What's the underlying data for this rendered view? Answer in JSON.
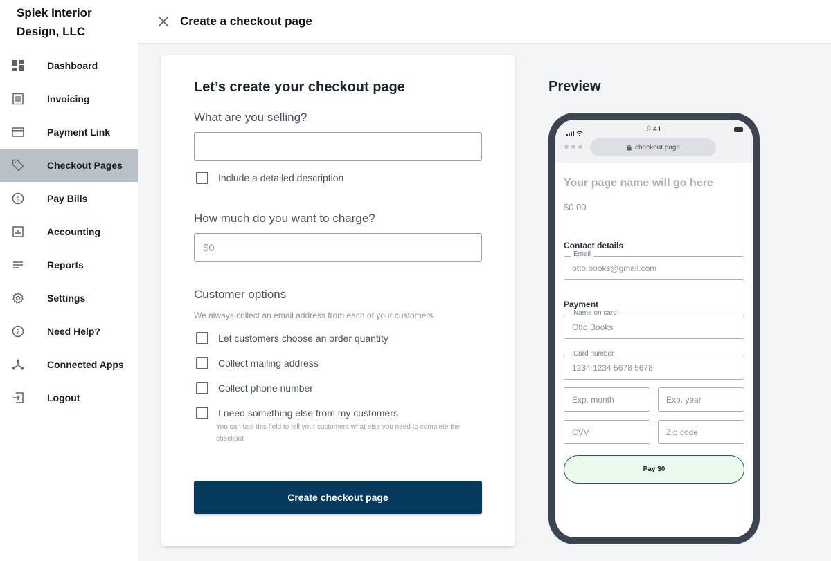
{
  "brand": {
    "name": "Spiek Interior Design, LLC"
  },
  "sidebar": {
    "items": [
      {
        "label": "Dashboard",
        "icon": "dashboard-icon"
      },
      {
        "label": "Invoicing",
        "icon": "invoice-icon"
      },
      {
        "label": "Payment Link",
        "icon": "credit-card-icon"
      },
      {
        "label": "Checkout Pages",
        "icon": "tag-icon",
        "active": true
      },
      {
        "label": "Pay Bills",
        "icon": "dollar-circle-icon"
      },
      {
        "label": "Accounting",
        "icon": "bar-chart-icon"
      },
      {
        "label": "Reports",
        "icon": "lines-icon"
      },
      {
        "label": "Settings",
        "icon": "gear-icon"
      },
      {
        "label": "Need Help?",
        "icon": "help-circle-icon"
      },
      {
        "label": "Connected Apps",
        "icon": "connected-nodes-icon"
      },
      {
        "label": "Logout",
        "icon": "logout-icon"
      }
    ]
  },
  "header": {
    "title": "Create a checkout page"
  },
  "form": {
    "title": "Let’s create your checkout page",
    "selling_label": "What are you selling?",
    "selling_value": "",
    "description_checkbox": "Include a detailed description",
    "charge_label": "How much do you want to charge?",
    "charge_placeholder": "$0",
    "customer_options_title": "Customer options",
    "customer_options_helper": "We always collect an email address from each of your customers",
    "options": [
      "Let customers choose an order quantity",
      "Collect mailing address",
      "Collect phone number",
      "I need something else from my customers"
    ],
    "something_else_helper": "You can use this field to tell your customers what else you need to complete the checkout",
    "submit_label": "Create checkout page"
  },
  "preview": {
    "title": "Preview",
    "time": "9:41",
    "url": "checkout.page",
    "page_name": "Your page name will go here",
    "amount": "$0.00",
    "contact_title": "Contact details",
    "email_label": "Email",
    "email_value": "otto.books@gmail.com",
    "payment_title": "Payment",
    "name_label": "Name on card",
    "name_value": "Otto Books",
    "card_label": "Card number",
    "card_value": "1234 1234 5678 5678",
    "exp_month": "Exp. month",
    "exp_year": "Exp. year",
    "cvv": "CVV",
    "zip": "Zip code",
    "pay_label": "Pay $0"
  },
  "colors": {
    "primary": "#053a5c",
    "sidebar_active": "#b9c0c8",
    "pay_button_bg": "#eafaef",
    "phone_frame": "#3c4452"
  }
}
